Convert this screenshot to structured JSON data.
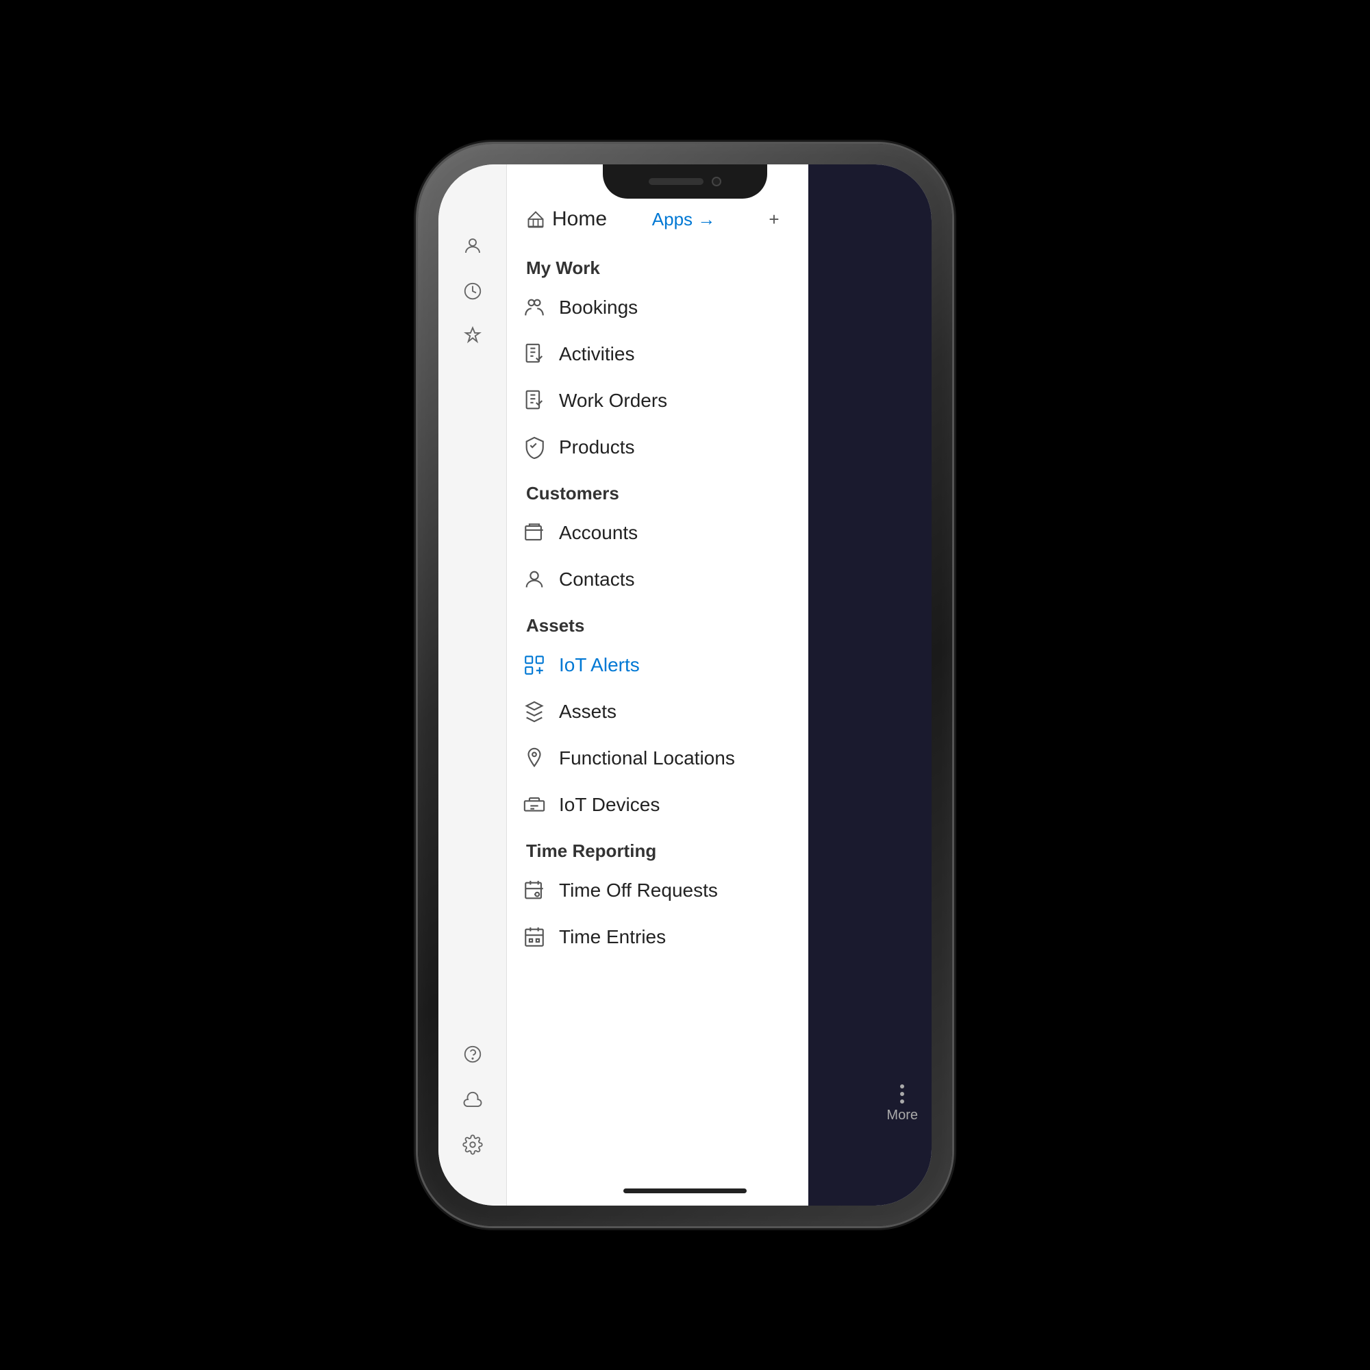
{
  "phone": {
    "sidebar": {
      "icons": [
        {
          "name": "profile-icon",
          "symbol": "person"
        },
        {
          "name": "clock-icon",
          "symbol": "clock"
        },
        {
          "name": "pin-icon",
          "symbol": "pin"
        }
      ],
      "bottom_icons": [
        {
          "name": "help-icon",
          "symbol": "help"
        },
        {
          "name": "cloud-icon",
          "symbol": "cloud"
        },
        {
          "name": "settings-icon",
          "symbol": "gear"
        }
      ]
    },
    "menu": {
      "home_label": "Home",
      "apps_label": "Apps →",
      "plus_label": "+",
      "sections": [
        {
          "name": "my-work",
          "label": "My Work",
          "items": [
            {
              "id": "bookings",
              "label": "Bookings",
              "icon": "people-icon"
            },
            {
              "id": "activities",
              "label": "Activities",
              "icon": "clipboard-icon"
            },
            {
              "id": "work-orders",
              "label": "Work Orders",
              "icon": "clipboard-check-icon"
            },
            {
              "id": "products",
              "label": "Products",
              "icon": "box-icon"
            }
          ]
        },
        {
          "name": "customers",
          "label": "Customers",
          "items": [
            {
              "id": "accounts",
              "label": "Accounts",
              "icon": "building-icon"
            },
            {
              "id": "contacts",
              "label": "Contacts",
              "icon": "person-icon"
            }
          ]
        },
        {
          "name": "assets",
          "label": "Assets",
          "items": [
            {
              "id": "iot-alerts",
              "label": "IoT Alerts",
              "icon": "iot-icon",
              "active": true
            },
            {
              "id": "assets",
              "label": "Assets",
              "icon": "cube-icon"
            },
            {
              "id": "functional-locations",
              "label": "Functional Locations",
              "icon": "location-icon"
            },
            {
              "id": "iot-devices",
              "label": "IoT Devices",
              "icon": "toolbox-icon"
            }
          ]
        },
        {
          "name": "time-reporting",
          "label": "Time Reporting",
          "items": [
            {
              "id": "time-off-requests",
              "label": "Time Off Requests",
              "icon": "calendar-person-icon"
            },
            {
              "id": "time-entries",
              "label": "Time Entries",
              "icon": "calendar-icon"
            }
          ]
        }
      ]
    }
  }
}
